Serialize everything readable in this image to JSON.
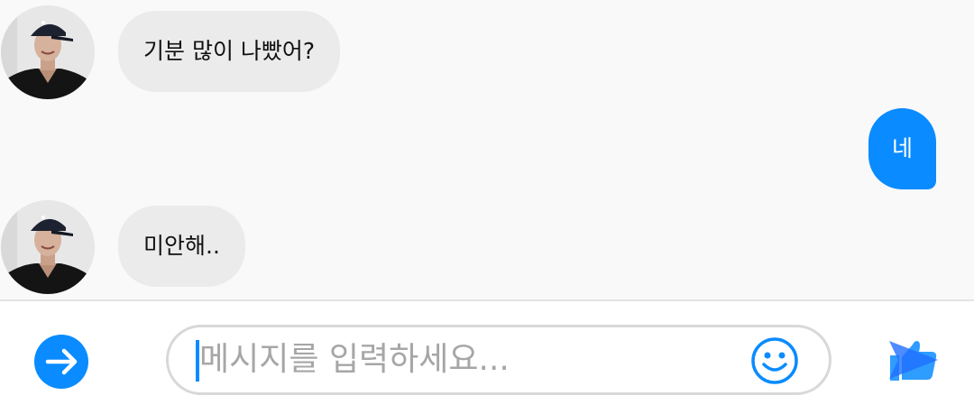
{
  "messages": [
    {
      "sender": "other",
      "text": "기분 많이 나빴어?"
    },
    {
      "sender": "me",
      "text": "네"
    },
    {
      "sender": "other",
      "text": "미안해.."
    }
  ],
  "composer": {
    "placeholder": "메시지를 입력하세요...",
    "left_icon": "arrow-right-icon",
    "emoji_icon": "smiley-icon",
    "send_icon": "send-like-icon"
  },
  "colors": {
    "accent": "#0a8bff",
    "incoming_bubble": "#ebebeb",
    "outgoing_bubble": "#0a8bff",
    "background": "#f9f9f9"
  }
}
